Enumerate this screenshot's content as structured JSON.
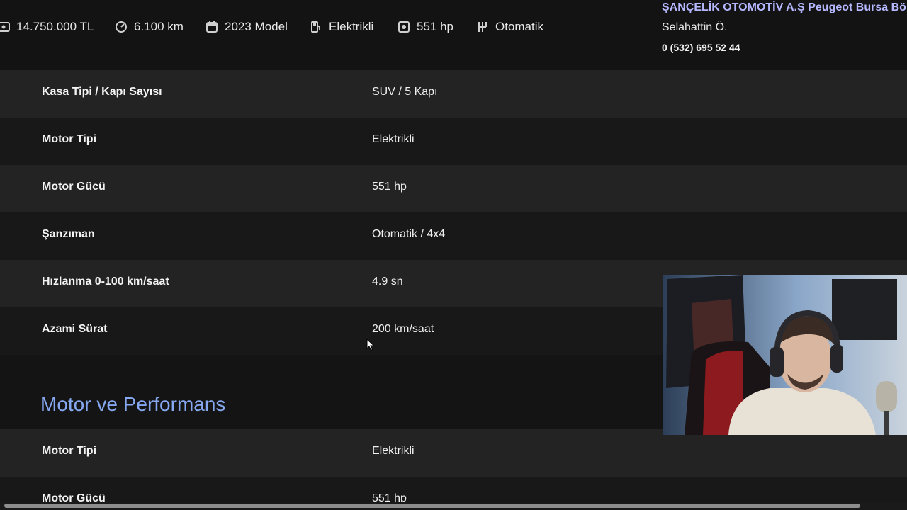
{
  "summary": {
    "price": "14.750.000 TL",
    "mileage": "6.100 km",
    "model_year": "2023 Model",
    "fuel": "Elektrikli",
    "power": "551 hp",
    "transmission": "Otomatik"
  },
  "dealer": {
    "name": "ŞANÇELİK OTOMOTİV A.Ş Peugeot Bursa Bölg...",
    "contact_name": "Selahattin Ö.",
    "phone": "0 (532) 695 52 44"
  },
  "spec_rows": [
    {
      "label": "Kasa Tipi / Kapı Sayısı",
      "value": "SUV / 5 Kapı"
    },
    {
      "label": "Motor Tipi",
      "value": "Elektrikli"
    },
    {
      "label": "Motor Gücü",
      "value": "551 hp"
    },
    {
      "label": "Şanzıman",
      "value": "Otomatik / 4x4"
    },
    {
      "label": "Hızlanma 0-100 km/saat",
      "value": "4.9 sn"
    },
    {
      "label": "Azami Sürat",
      "value": "200 km/saat"
    }
  ],
  "section": {
    "title": "Motor ve Performans",
    "rows": [
      {
        "label": "Motor Tipi",
        "value": "Elektrikli"
      },
      {
        "label": "Motor Gücü",
        "value": "551 hp"
      }
    ]
  },
  "colors": {
    "background": "#141414",
    "row_light": "#232323",
    "row_dark": "#181818",
    "dealer_name": "#b6b8ff",
    "section_heading": "#86a8f0"
  },
  "icons": {
    "price": "cash-icon",
    "mileage": "speedometer-icon",
    "model_year": "calendar-icon",
    "fuel": "fuel-pump-icon",
    "power": "engine-icon",
    "transmission": "gearbox-icon"
  }
}
